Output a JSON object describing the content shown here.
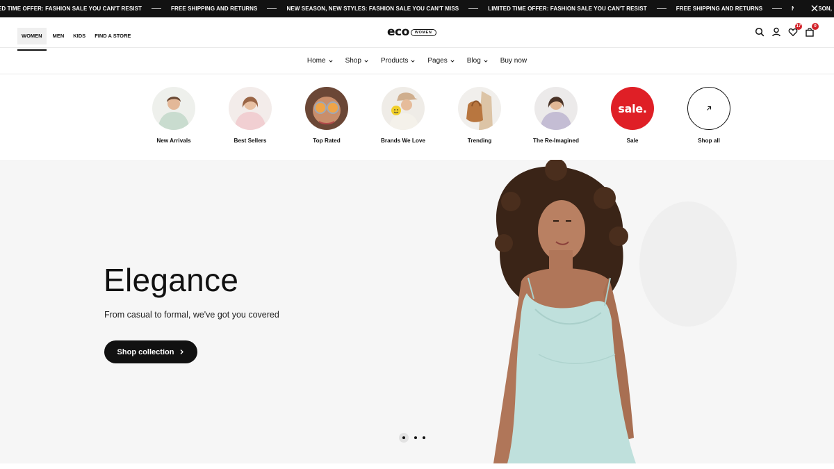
{
  "announcement": {
    "items": [
      "TED TIME OFFER: FASHION SALE YOU CAN'T RESIST",
      "FREE SHIPPING AND RETURNS",
      "NEW SEASON, NEW STYLES: FASHION SALE YOU CAN'T MISS",
      "LIMITED TIME OFFER: FASHION SALE YOU CAN'T RESIST",
      "FREE SHIPPING AND RETURNS",
      "NEW SEASON, NEW STYLES: FAS"
    ],
    "close_icon": "close-icon"
  },
  "header": {
    "gender_tabs": [
      "WOMEN",
      "MEN",
      "KIDS",
      "FIND A STORE"
    ],
    "active_tab": "WOMEN",
    "logo": {
      "word": "eco",
      "badge": "WOMEN"
    },
    "icons": {
      "search": "search-icon",
      "account": "user-icon",
      "wishlist": "heart-icon",
      "cart": "bag-icon"
    },
    "wishlist_count": "17",
    "cart_count": "0"
  },
  "nav": {
    "items": [
      {
        "label": "Home",
        "dropdown": true
      },
      {
        "label": "Shop",
        "dropdown": true
      },
      {
        "label": "Products",
        "dropdown": true
      },
      {
        "label": "Pages",
        "dropdown": true
      },
      {
        "label": "Blog",
        "dropdown": true
      },
      {
        "label": "Buy now",
        "dropdown": false
      }
    ]
  },
  "categories": [
    {
      "label": "New Arrivals"
    },
    {
      "label": "Best Sellers"
    },
    {
      "label": "Top Rated"
    },
    {
      "label": "Brands We Love"
    },
    {
      "label": "Trending"
    },
    {
      "label": "The Re-Imagined"
    },
    {
      "label": "Sale",
      "circle_text": "sale."
    },
    {
      "label": "Shop all",
      "icon": "arrow-up-right-icon"
    }
  ],
  "hero": {
    "title": "Elegance",
    "subtitle": "From casual to formal, we've got you covered",
    "button_label": "Shop collection",
    "slide_count": 3,
    "active_slide": 1
  },
  "colors": {
    "announcement_bg": "#121212",
    "badge": "#d3222a",
    "sale": "#df1f26",
    "hero_bg": "#f6f6f6",
    "dress": "#bfe0dc"
  }
}
